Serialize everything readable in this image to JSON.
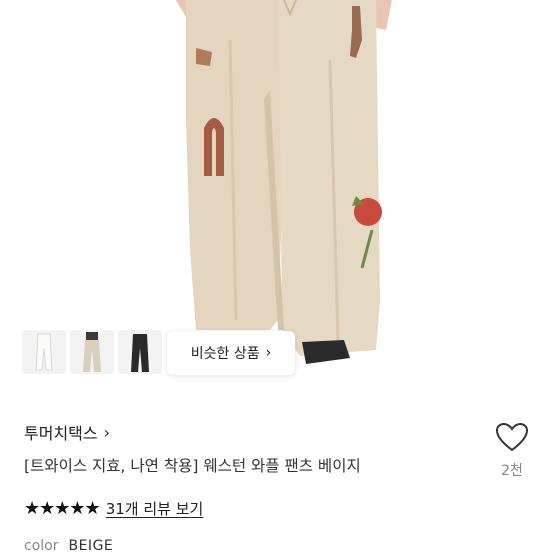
{
  "similar_button": {
    "label": "비슷한 상품",
    "chevron": "chevron-right-icon"
  },
  "thumbnails": [
    {
      "alt": "white-pants-thumbnail",
      "color": "#f4f4f2"
    },
    {
      "alt": "beige-pants-thumbnail",
      "color": "#d9cfbd"
    },
    {
      "alt": "black-pants-thumbnail",
      "color": "#2b2b2b"
    }
  ],
  "product": {
    "brand": "투머치택스",
    "title": "[트와이스 지효, 나연 착용] 웨스턴 와플 팬츠 베이지",
    "likes": "2천",
    "rating_stars": "★★★★★",
    "review_link": "31개 리뷰 보기",
    "color_label": "color",
    "color_value": "BEIGE"
  },
  "colors": {
    "pants": "#e2d4bd",
    "accent_red": "#c94a3f",
    "star": "#111111"
  }
}
